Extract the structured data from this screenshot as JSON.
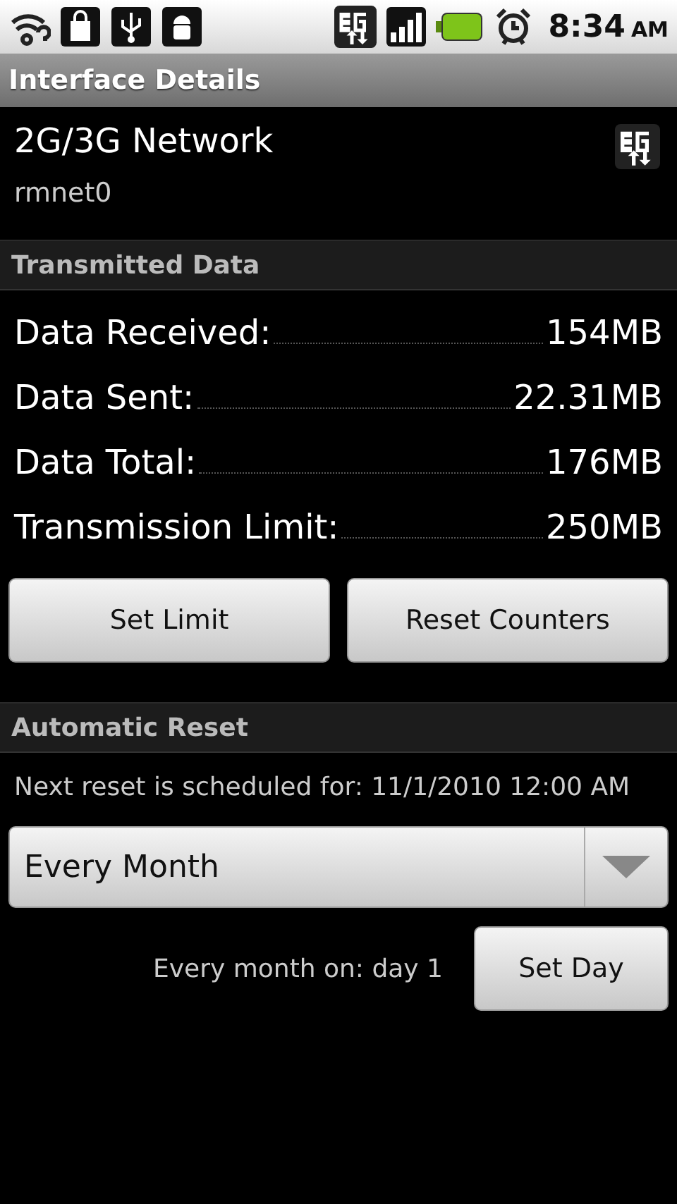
{
  "status_bar": {
    "time": "8:34",
    "ampm": "AM"
  },
  "title_bar": {
    "title": "Interface Details"
  },
  "interface": {
    "name": "2G/3G Network",
    "device": "rmnet0"
  },
  "transmitted": {
    "header": "Transmitted Data",
    "rows": [
      {
        "label": "Data Received:",
        "value": "154MB"
      },
      {
        "label": "Data Sent:",
        "value": "22.31MB"
      },
      {
        "label": "Data Total:",
        "value": "176MB"
      },
      {
        "label": "Transmission Limit:",
        "value": "250MB"
      }
    ],
    "buttons": [
      "Set Limit",
      "Reset Counters"
    ]
  },
  "automatic_reset": {
    "header": "Automatic Reset",
    "next_reset": "Next reset is scheduled for: 11/1/2010 12:00 AM",
    "dropdown": {
      "value": "Every Month"
    },
    "day_text": "Every month on: day 1",
    "button": "Set Day"
  }
}
